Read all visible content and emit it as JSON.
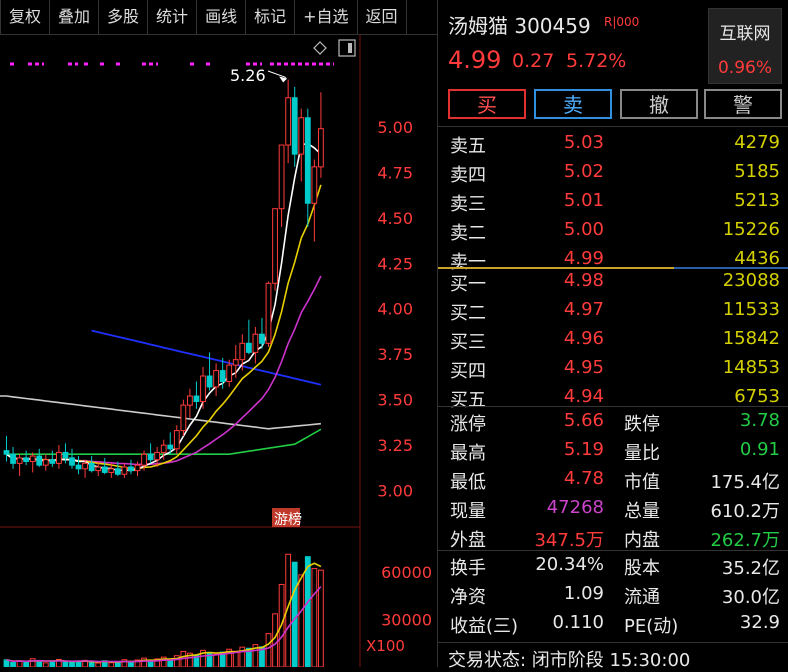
{
  "toolbar": {
    "items": [
      "复权",
      "叠加",
      "多股",
      "统计",
      "画线",
      "标记",
      "+自选",
      "返回"
    ]
  },
  "chart": {
    "peak_label": "5.26",
    "price_axis": [
      "5.00",
      "4.75",
      "4.50",
      "4.25",
      "4.00",
      "3.75",
      "3.50",
      "3.25",
      "3.00"
    ],
    "badge_label": "游榜",
    "volume_axis": [
      "60000",
      "30000"
    ],
    "volume_unit": "X100"
  },
  "chart_data": {
    "type": "candlestick",
    "price_ylim": [
      2.8,
      5.45
    ],
    "price_ticks": [
      5.0,
      4.75,
      4.5,
      4.25,
      4.0,
      3.75,
      3.5,
      3.25,
      3.0
    ],
    "volume_ticks": [
      60000,
      30000
    ],
    "volume_unit": "X100",
    "peak_annotation": 5.26,
    "colors": {
      "up": "#ff3b3b",
      "down": "#00cccc",
      "ma5": "#ffffff",
      "ma10": "#e8d000",
      "ma20": "#cc33cc",
      "ma60": "#22cc44",
      "ma120": "#2030ff",
      "ma250": "#cccccc",
      "vol_ma5": "#e8d000",
      "vol_ma10": "#cc33cc"
    },
    "candles": [
      [
        3.22,
        3.3,
        3.16,
        3.2
      ],
      [
        3.2,
        3.24,
        3.12,
        3.15
      ],
      [
        3.15,
        3.2,
        3.08,
        3.18
      ],
      [
        3.18,
        3.22,
        3.14,
        3.16
      ],
      [
        3.16,
        3.21,
        3.1,
        3.19
      ],
      [
        3.19,
        3.23,
        3.13,
        3.14
      ],
      [
        3.14,
        3.2,
        3.11,
        3.17
      ],
      [
        3.17,
        3.22,
        3.13,
        3.15
      ],
      [
        3.15,
        3.25,
        3.12,
        3.21
      ],
      [
        3.21,
        3.26,
        3.15,
        3.18
      ],
      [
        3.18,
        3.23,
        3.12,
        3.14
      ],
      [
        3.14,
        3.19,
        3.09,
        3.12
      ],
      [
        3.12,
        3.17,
        3.07,
        3.15
      ],
      [
        3.15,
        3.19,
        3.1,
        3.11
      ],
      [
        3.11,
        3.16,
        3.08,
        3.13
      ],
      [
        3.13,
        3.18,
        3.09,
        3.1
      ],
      [
        3.1,
        3.15,
        3.07,
        3.12
      ],
      [
        3.12,
        3.16,
        3.08,
        3.09
      ],
      [
        3.09,
        3.15,
        3.07,
        3.13
      ],
      [
        3.13,
        3.17,
        3.09,
        3.11
      ],
      [
        3.11,
        3.16,
        3.08,
        3.14
      ],
      [
        3.14,
        3.22,
        3.11,
        3.2
      ],
      [
        3.2,
        3.26,
        3.15,
        3.17
      ],
      [
        3.17,
        3.24,
        3.13,
        3.21
      ],
      [
        3.21,
        3.28,
        3.17,
        3.25
      ],
      [
        3.25,
        3.32,
        3.2,
        3.23
      ],
      [
        3.23,
        3.36,
        3.2,
        3.33
      ],
      [
        3.33,
        3.5,
        3.3,
        3.47
      ],
      [
        3.47,
        3.56,
        3.4,
        3.52
      ],
      [
        3.52,
        3.6,
        3.45,
        3.49
      ],
      [
        3.49,
        3.68,
        3.45,
        3.63
      ],
      [
        3.63,
        3.76,
        3.55,
        3.57
      ],
      [
        3.57,
        3.7,
        3.52,
        3.66
      ],
      [
        3.66,
        3.73,
        3.56,
        3.6
      ],
      [
        3.6,
        3.72,
        3.57,
        3.69
      ],
      [
        3.69,
        3.8,
        3.62,
        3.72
      ],
      [
        3.72,
        3.86,
        3.66,
        3.81
      ],
      [
        3.81,
        3.94,
        3.75,
        3.76
      ],
      [
        3.76,
        3.9,
        3.7,
        3.86
      ],
      [
        3.86,
        3.95,
        3.78,
        3.81
      ],
      [
        3.81,
        4.15,
        3.79,
        4.14
      ],
      [
        4.14,
        4.55,
        4.1,
        4.55
      ],
      [
        4.55,
        4.9,
        4.45,
        4.9
      ],
      [
        4.9,
        5.26,
        4.8,
        5.16
      ],
      [
        5.16,
        5.22,
        4.78,
        4.85
      ],
      [
        4.85,
        5.1,
        4.7,
        5.05
      ],
      [
        5.05,
        5.1,
        4.45,
        4.58
      ],
      [
        4.58,
        4.82,
        4.37,
        4.78
      ],
      [
        4.78,
        5.19,
        4.72,
        4.99
      ]
    ],
    "volumes": [
      4500,
      2800,
      3900,
      3200,
      5200,
      4100,
      2600,
      3800,
      4700,
      3300,
      2900,
      3600,
      4200,
      3100,
      2500,
      3900,
      2700,
      3400,
      4600,
      3000,
      4400,
      5600,
      3700,
      5100,
      6200,
      4800,
      7100,
      9800,
      8700,
      7600,
      10500,
      9200,
      8100,
      9400,
      11200,
      9900,
      12500,
      11800,
      14100,
      12700,
      21000,
      33500,
      52000,
      71000,
      66000,
      58000,
      69500,
      62000,
      61000
    ]
  },
  "quote": {
    "name": "汤姆猫",
    "code": "300459",
    "tags": "R|000",
    "price": "4.99",
    "change": "0.27",
    "change_pct": "5.72%",
    "sector_name": "互联网",
    "sector_pct": "0.96%"
  },
  "trade_buttons": {
    "buy": "买",
    "sell": "卖",
    "cancel": "撤",
    "alert": "警"
  },
  "asks": [
    {
      "label": "卖五",
      "price": "5.03",
      "volume": "4279"
    },
    {
      "label": "卖四",
      "price": "5.02",
      "volume": "5185"
    },
    {
      "label": "卖三",
      "price": "5.01",
      "volume": "5213"
    },
    {
      "label": "卖二",
      "price": "5.00",
      "volume": "15226"
    },
    {
      "label": "卖一",
      "price": "4.99",
      "volume": "4436"
    }
  ],
  "bids": [
    {
      "label": "买一",
      "price": "4.98",
      "volume": "23088"
    },
    {
      "label": "买二",
      "price": "4.97",
      "volume": "11533"
    },
    {
      "label": "买三",
      "price": "4.96",
      "volume": "15842"
    },
    {
      "label": "买四",
      "price": "4.95",
      "volume": "14853"
    },
    {
      "label": "买五",
      "price": "4.94",
      "volume": "6753"
    }
  ],
  "stats": {
    "limit_up_label": "涨停",
    "limit_up": "5.66",
    "limit_down_label": "跌停",
    "limit_down": "3.78",
    "high_label": "最高",
    "high": "5.19",
    "vol_ratio_label": "量比",
    "vol_ratio": "0.91",
    "low_label": "最低",
    "low": "4.78",
    "mkt_cap_label": "市值",
    "mkt_cap": "175.4亿",
    "cur_vol_label": "现量",
    "cur_vol": "47268",
    "total_vol_label": "总量",
    "total_vol": "610.2万",
    "outer_label": "外盘",
    "outer": "347.5万",
    "inner_label": "内盘",
    "inner": "262.7万",
    "turnover_label": "换手",
    "turnover": "20.34%",
    "capital_label": "股本",
    "capital": "35.2亿",
    "net_assets_label": "净资",
    "net_assets": "1.09",
    "float_label": "流通",
    "float": "30.0亿",
    "eps_label": "收益(三)",
    "eps": "0.110",
    "pe_label": "PE(动)",
    "pe": "32.9"
  },
  "status_bar": {
    "text": "交易状态: 闭市阶段 15:30:00"
  }
}
